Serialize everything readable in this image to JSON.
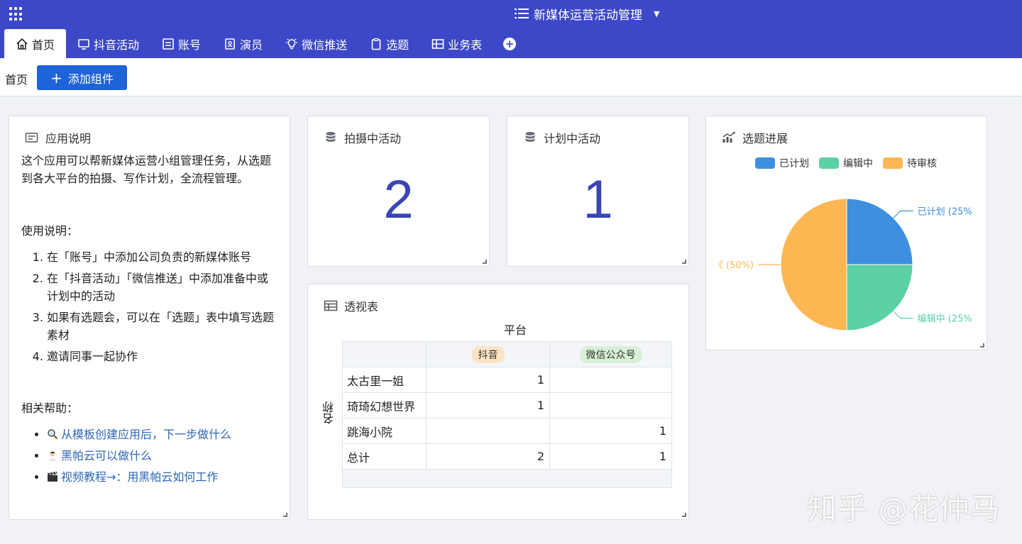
{
  "app": {
    "title": "新媒体运营活动管理"
  },
  "tabs": [
    {
      "label": "首页",
      "icon": "home-icon",
      "active": true
    },
    {
      "label": "抖音活动",
      "icon": "monitor-icon"
    },
    {
      "label": "账号",
      "icon": "id-card-icon"
    },
    {
      "label": "演员",
      "icon": "contact-icon"
    },
    {
      "label": "微信推送",
      "icon": "bulb-icon"
    },
    {
      "label": "选题",
      "icon": "clipboard-icon"
    },
    {
      "label": "业务表",
      "icon": "table-icon"
    }
  ],
  "toolbar": {
    "breadcrumb": "首页",
    "add_label": "添加组件"
  },
  "intro": {
    "title": "应用说明",
    "paragraph": "这个应用可以帮新媒体运营小组管理任务，从选题到各大平台的拍摄、写作计划，全流程管理。",
    "usage_title": "使用说明：",
    "steps": [
      "在「账号」中添加公司负责的新媒体账号",
      "在「抖音活动」「微信推送」中添加准备中或计划中的活动",
      "如果有选题会，可以在「选题」表中填写选题素材",
      "邀请同事一起协作"
    ],
    "help_title": "相关帮助：",
    "links": [
      {
        "icon": "magnifier-icon",
        "text": "从模板创建应用后，下一步做什么"
      },
      {
        "icon": "person-icon",
        "text": "黑帕云可以做什么"
      },
      {
        "icon": "clapper-icon",
        "text": "视频教程→：用黑帕云如何工作"
      }
    ]
  },
  "stat1": {
    "title": "拍摄中活动",
    "value": "2"
  },
  "stat2": {
    "title": "计划中活动",
    "value": "1"
  },
  "pivot": {
    "title": "透视表",
    "col_header": "平台",
    "row_header": "名称",
    "columns": [
      {
        "label": "抖音",
        "color": "#fbe3c4"
      },
      {
        "label": "微信公众号",
        "color": "#d7f0d6"
      }
    ],
    "rows": [
      {
        "name": "太古里一姐",
        "values": [
          "1",
          ""
        ]
      },
      {
        "name": "琦琦幻想世界",
        "values": [
          "1",
          ""
        ]
      },
      {
        "name": "跳海小院",
        "values": [
          "",
          "1"
        ]
      },
      {
        "name": "总计",
        "values": [
          "2",
          "1"
        ]
      }
    ]
  },
  "pie": {
    "title": "选题进展",
    "chart_data": {
      "type": "pie",
      "categories": [
        "已计划",
        "编辑中",
        "待审核"
      ],
      "values": [
        25,
        25,
        50
      ],
      "colors": [
        "#3d8fe0",
        "#5bd1a5",
        "#fdb752"
      ],
      "labels": [
        "已计划 (25%",
        "编辑中 (25%",
        "《 (50%)"
      ],
      "legend": "top"
    }
  },
  "watermark": "知乎 @花仲马"
}
